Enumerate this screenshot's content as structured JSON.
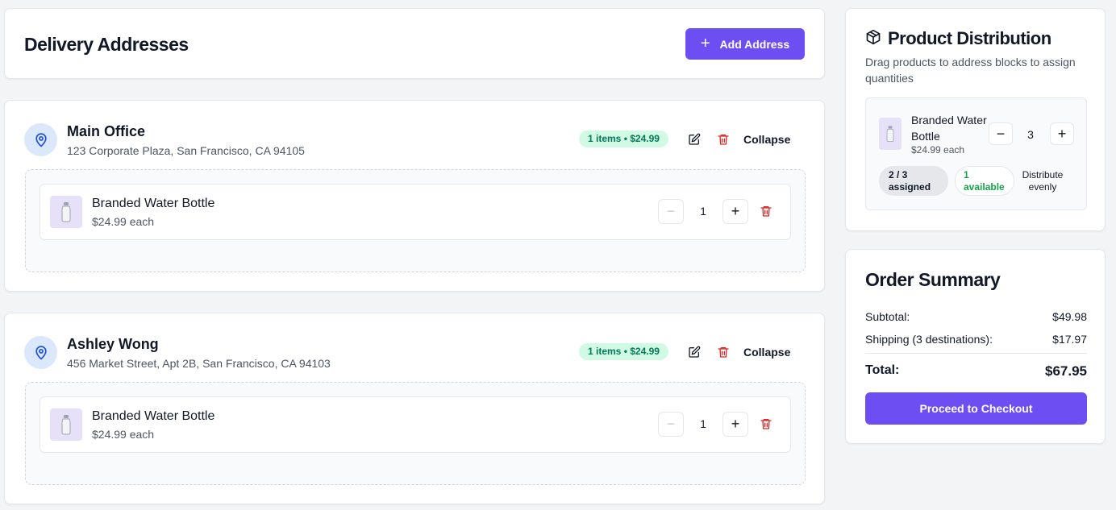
{
  "header": {
    "title": "Delivery Addresses",
    "add_address_label": "Add Address",
    "add_address_icon": "plus-icon"
  },
  "addresses": [
    {
      "name": "Main Office",
      "address": "123 Corporate Plaza, San Francisco, CA 94105",
      "badge": "1 items • $24.99",
      "collapse_label": "Collapse",
      "items": [
        {
          "name": "Branded Water Bottle",
          "price": "$24.99 each",
          "quantity": "1"
        }
      ]
    },
    {
      "name": "Ashley Wong",
      "address": "456 Market Street, Apt 2B, San Francisco, CA 94103",
      "badge": "1 items • $24.99",
      "collapse_label": "Collapse",
      "items": [
        {
          "name": "Branded Water Bottle",
          "price": "$24.99 each",
          "quantity": "1"
        }
      ]
    }
  ],
  "distribution": {
    "title": "Product Distribution",
    "subtitle": "Drag products to address blocks to assign quantities",
    "product": {
      "name": "Branded Water Bottle",
      "price": "$24.99 each",
      "quantity": "3",
      "assigned_line1": "2 / 3",
      "assigned_line2": "assigned",
      "available_line1": "1",
      "available_line2": "available",
      "distribute_line1": "Distribute",
      "distribute_line2": "evenly"
    }
  },
  "summary": {
    "title": "Order Summary",
    "subtotal_label": "Subtotal:",
    "subtotal_value": "$49.98",
    "shipping_label": "Shipping (3 destinations):",
    "shipping_value": "$17.97",
    "total_label": "Total:",
    "total_value": "$67.95",
    "checkout_label": "Proceed to Checkout"
  },
  "colors": {
    "primary": "#6d4ef2",
    "badge_bg": "#d1fae5",
    "badge_text": "#047857",
    "pin_bg": "#dbe8fb",
    "pin_stroke": "#1d4ed8",
    "danger": "#dc2626",
    "available_text": "#16a34a"
  }
}
